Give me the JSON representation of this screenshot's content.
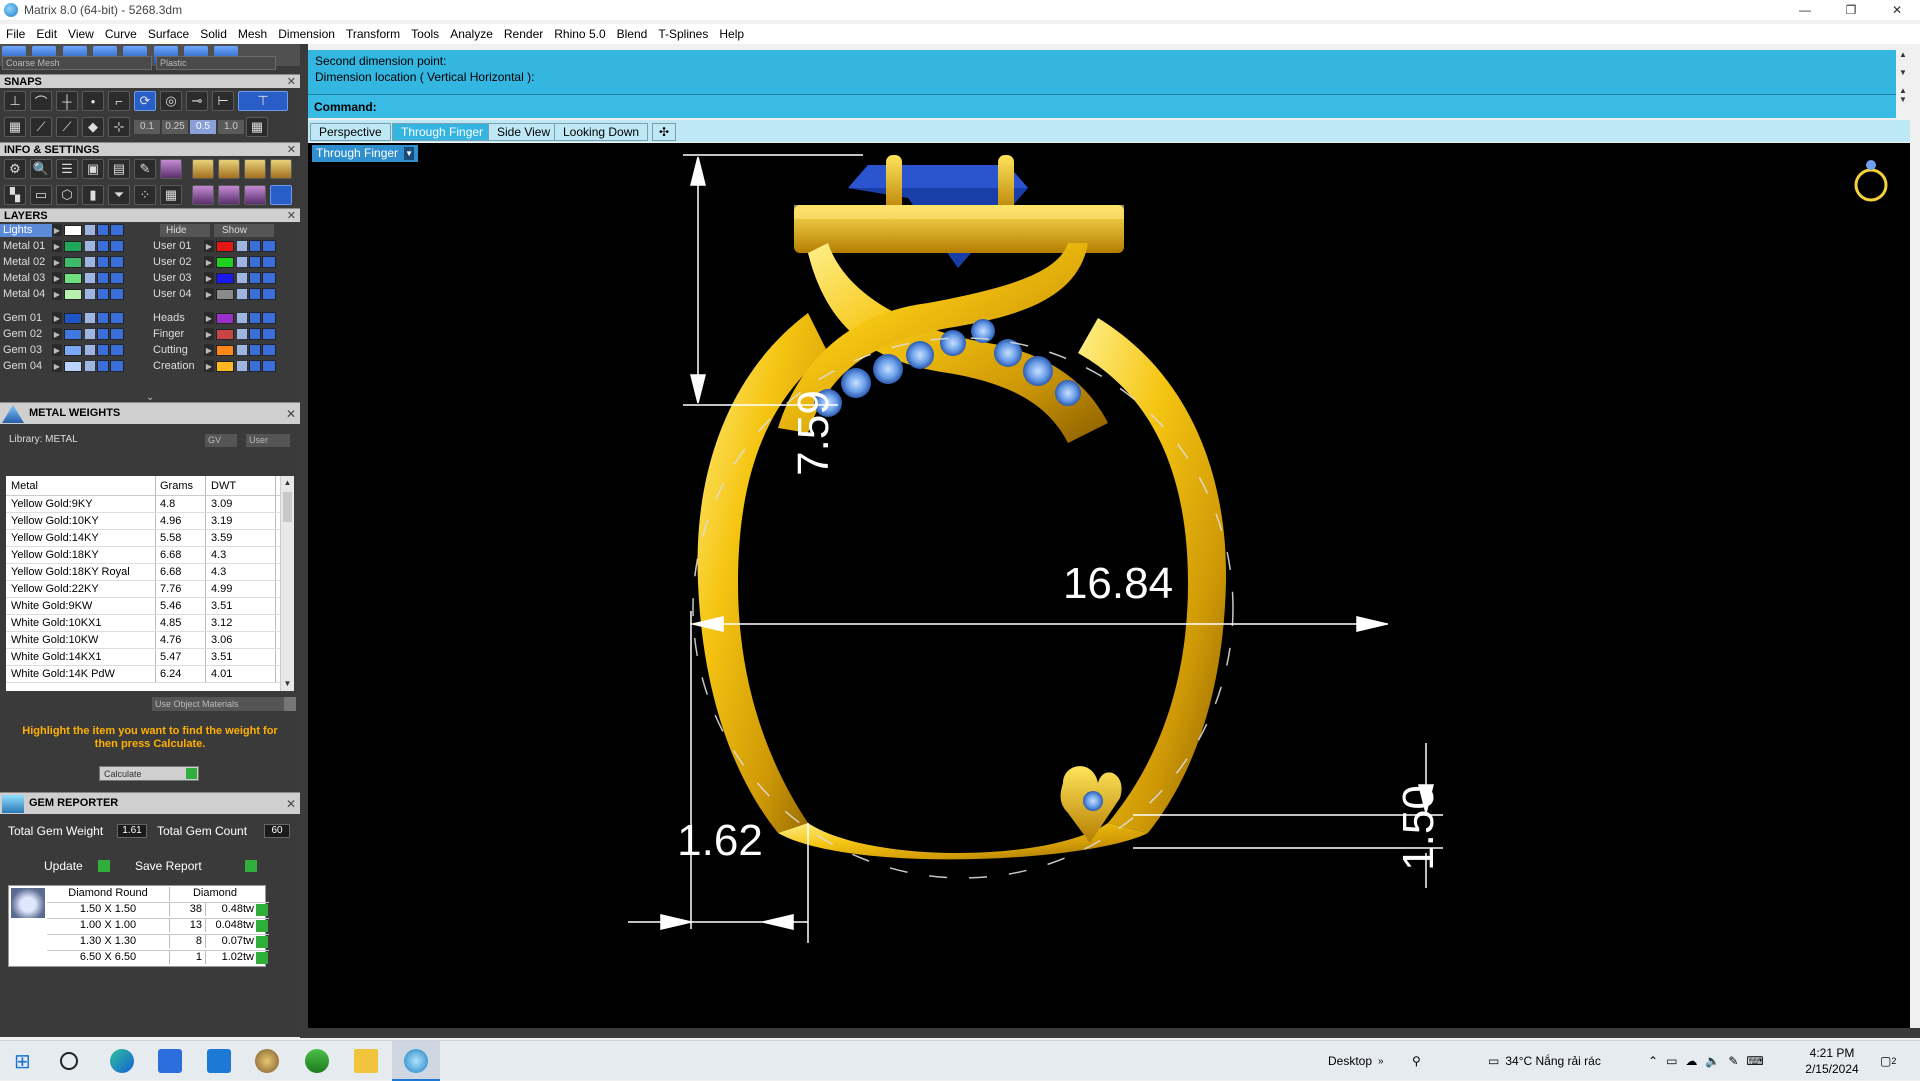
{
  "window": {
    "title": "Matrix 8.0 (64-bit) - 5268.3dm",
    "minimize": "—",
    "restore": "❐",
    "close": "✕"
  },
  "menu": [
    "File",
    "Edit",
    "View",
    "Curve",
    "Surface",
    "Solid",
    "Mesh",
    "Dimension",
    "Transform",
    "Tools",
    "Analyze",
    "Render",
    "Rhino 5.0",
    "Blend",
    "T-Splines",
    "Help"
  ],
  "toolbar": {
    "mesh_combo": "Coarse Mesh",
    "material_combo": "Plastic"
  },
  "snaps": {
    "title": "SNAPS",
    "values": [
      "0.1",
      "0.25",
      "0.5",
      "1.0"
    ],
    "selected": "0.5"
  },
  "info": {
    "title": "INFO & SETTINGS"
  },
  "layers": {
    "title": "LAYERS",
    "lights": "Lights",
    "hide": "Hide",
    "show": "Show",
    "left": [
      {
        "name": "Metal 01",
        "color": "#1fa85b"
      },
      {
        "name": "Metal 02",
        "color": "#3dbb6a"
      },
      {
        "name": "Metal 03",
        "color": "#6ee07d"
      },
      {
        "name": "Metal 04",
        "color": "#b8f0b0"
      },
      {
        "name": "Gem 01",
        "color": "#1f56c7"
      },
      {
        "name": "Gem 02",
        "color": "#3e78e0"
      },
      {
        "name": "Gem 03",
        "color": "#7aaaf5"
      },
      {
        "name": "Gem 04",
        "color": "#b9d3ff"
      }
    ],
    "right": [
      {
        "name": "User 01",
        "color": "#e41616"
      },
      {
        "name": "User 02",
        "color": "#1fd11f"
      },
      {
        "name": "User 03",
        "color": "#1a1af0"
      },
      {
        "name": "User 04",
        "color": "#8a8a8a"
      },
      {
        "name": "Heads",
        "color": "#9b2fc9"
      },
      {
        "name": "Finger",
        "color": "#c84545"
      },
      {
        "name": "Cutting",
        "color": "#ff8a1a"
      },
      {
        "name": "Creation",
        "color": "#ffb820"
      }
    ]
  },
  "metal_weights": {
    "title": "METAL WEIGHTS",
    "library": "Library: METAL",
    "gv": "GV",
    "user": "User",
    "headers": [
      "Metal",
      "Grams",
      "DWT"
    ],
    "rows": [
      [
        "Yellow Gold:9KY",
        "4.8",
        "3.09"
      ],
      [
        "Yellow Gold:10KY",
        "4.96",
        "3.19"
      ],
      [
        "Yellow Gold:14KY",
        "5.58",
        "3.59"
      ],
      [
        "Yellow Gold:18KY",
        "6.68",
        "4.3"
      ],
      [
        "Yellow Gold:18KY Royal",
        "6.68",
        "4.3"
      ],
      [
        "Yellow Gold:22KY",
        "7.76",
        "4.99"
      ],
      [
        "White Gold:9KW",
        "5.46",
        "3.51"
      ],
      [
        "White Gold:10KX1",
        "4.85",
        "3.12"
      ],
      [
        "White Gold:10KW",
        "4.76",
        "3.06"
      ],
      [
        "White Gold:14KX1",
        "5.47",
        "3.51"
      ],
      [
        "White Gold:14K PdW",
        "6.24",
        "4.01"
      ]
    ],
    "use_object_materials": "Use Object Materials",
    "hint": "Highlight the item you want to find the weight for then press Calculate.",
    "calculate": "Calculate"
  },
  "gem_reporter": {
    "title": "GEM REPORTER",
    "total_weight_label": "Total Gem Weight",
    "total_weight": "1.61",
    "total_count_label": "Total Gem Count",
    "total_count": "60",
    "update": "Update",
    "save_report": "Save Report",
    "headers": [
      "Diamond Round",
      "Diamond"
    ],
    "rows": [
      [
        "1.50 X 1.50",
        "38",
        "0.48tw"
      ],
      [
        "1.00 X 1.00",
        "13",
        "0.048tw"
      ],
      [
        "1.30 X 1.30",
        "8",
        "0.07tw"
      ],
      [
        "6.50 X 6.50",
        "1",
        "1.02tw"
      ]
    ]
  },
  "command": {
    "line1": "Second dimension point:",
    "line2": "Dimension location ( Vertical  Horizontal ):",
    "prompt": "Command:"
  },
  "view_tabs": [
    "Perspective",
    "Through Finger",
    "Side View",
    "Looking Down",
    "✣"
  ],
  "active_tab": "Through Finger",
  "viewport": {
    "label": "Through Finger",
    "dim_height": "7.59",
    "dim_inner": "16.84",
    "dim_shank": "1.62",
    "dim_bottom": "1.50"
  },
  "taskbar": {
    "desktop": "Desktop",
    "weather": "34°C  Nắng rải rác",
    "time": "4:21 PM",
    "date": "2/15/2024",
    "notif": "2"
  }
}
